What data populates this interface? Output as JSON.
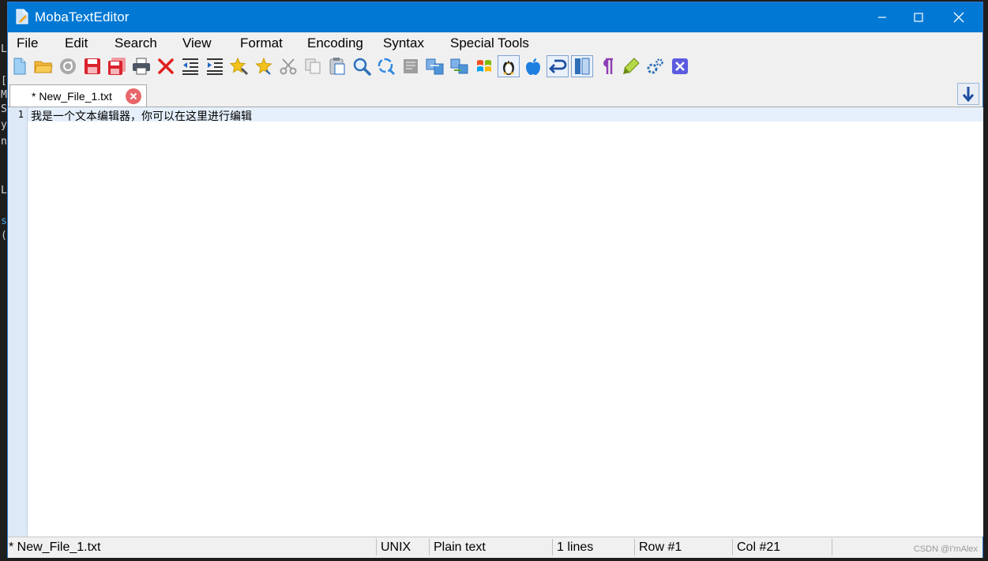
{
  "window": {
    "title": "MobaTextEditor"
  },
  "menu": [
    "File",
    "Edit",
    "Search",
    "View",
    "Format",
    "Encoding",
    "Syntax",
    "Special Tools"
  ],
  "toolbar_icons": [
    "new-file-icon",
    "open-folder-icon",
    "reload-icon",
    "save-icon",
    "save-as-icon",
    "print-icon",
    "close-file-icon",
    "unindent-icon",
    "indent-icon",
    "bookmark-toggle-icon",
    "bookmark-next-icon",
    "cut-icon",
    "copy-icon",
    "paste-icon",
    "search-icon",
    "replace-icon",
    "document-icon",
    "compare-icon",
    "merge-icon",
    "windows-eol-icon",
    "linux-eol-icon",
    "mac-eol-icon",
    "undo-wrap-icon",
    "columns-icon",
    "pilcrow-icon",
    "highlight-icon",
    "settings-icon",
    "exit-icon"
  ],
  "tab": {
    "label": "* New_File_1.txt"
  },
  "editor": {
    "line_number": "1",
    "line_text": "我是一个文本编辑器，你可以在这里进行编辑"
  },
  "status": {
    "file": "* New_File_1.txt",
    "eol": "UNIX",
    "syntax": "Plain text",
    "lines": "1 lines",
    "row": "Row #1",
    "col": "Col #21"
  },
  "background_text": [
    "L",
    "[",
    "M",
    "S",
    "y",
    "n",
    "L",
    "s",
    "("
  ],
  "watermark": "CSDN @I'mAlex",
  "colors": {
    "titlebar": "#0078d4",
    "gutter": "#dde9f7",
    "current_line": "#e6f0fc",
    "tab_close": "#e8676b"
  }
}
